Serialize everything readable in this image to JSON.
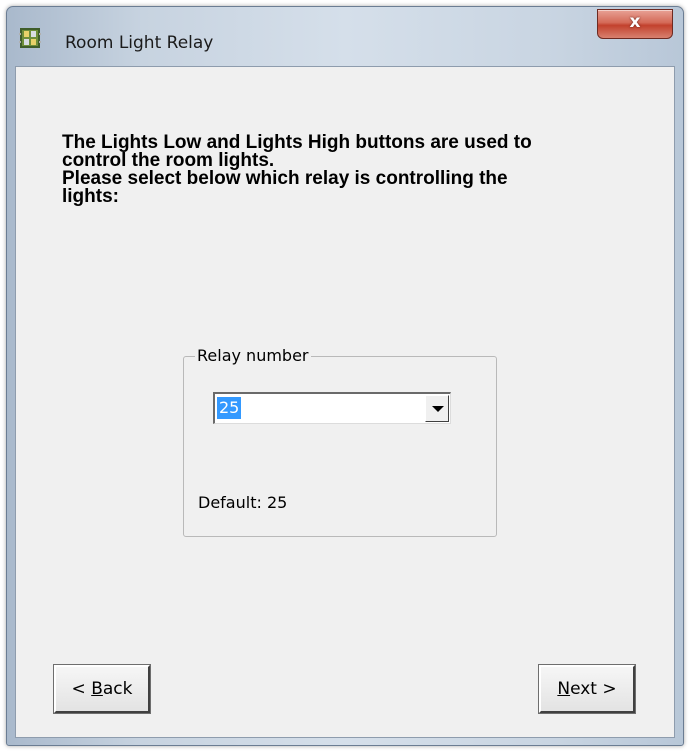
{
  "window": {
    "title": "Room Light Relay",
    "close_glyph": "x",
    "icon": "relay-board-icon",
    "close_color": "#c8452f"
  },
  "instructions": {
    "line1": "The Lights Low and Lights High buttons are used to",
    "line2": "control the room lights.",
    "line3": "Please select below which relay is controlling the",
    "line4": "lights:"
  },
  "relay_group": {
    "legend": "Relay number",
    "selected_value": "25",
    "default_label": "Default: 25",
    "selection_color": "#3399ff"
  },
  "buttons": {
    "back_prefix": "< ",
    "back_mnemonic": "B",
    "back_rest": "ack",
    "next_mnemonic": "N",
    "next_rest": "ext >"
  }
}
